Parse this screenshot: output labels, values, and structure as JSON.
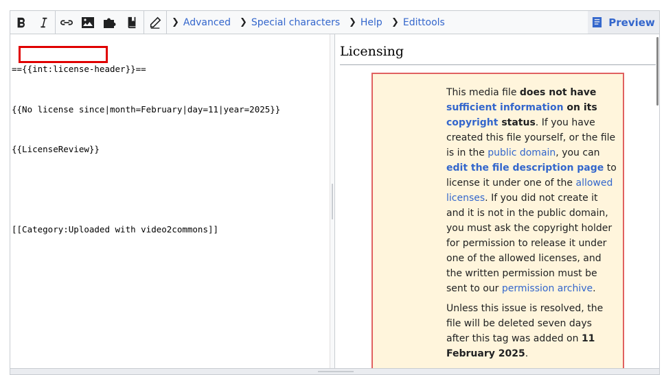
{
  "toolbar": {
    "tabs": [
      {
        "label": "Advanced"
      },
      {
        "label": "Special characters"
      },
      {
        "label": "Help"
      },
      {
        "label": "Edittools"
      }
    ],
    "preview_label": "Preview"
  },
  "editor": {
    "lines": [
      "=={{int:license-header}}==",
      "{{No license since|month=February|day=11|year=2025}}",
      "{{LicenseReview}}",
      "",
      "[[Category:Uploaded with video2commons]]"
    ]
  },
  "preview": {
    "heading": "Licensing",
    "notice": {
      "p1": {
        "t1": "This media file ",
        "b1": "does not have",
        "l1": "sufficient information",
        "b2": " on its",
        "l2": "copyright",
        "b3": " status",
        "t2": ". If you have created this file yourself, or the file is in the ",
        "l3": "public domain",
        "t3": ", you can ",
        "l4": "edit the file description page",
        "t4": " to license it under one of the ",
        "l5": "allowed licenses",
        "t5": ". If you did not create it and it is not in the public domain, you must ask the copyright holder for permission to release it under one of the allowed licenses, and the written permission must be sent to our ",
        "l6": "permission archive",
        "t6": "."
      },
      "p2": {
        "t1": "Unless this issue is resolved, the file will be deleted seven days after this tag was added on ",
        "b1": "11 February 2025",
        "t2": "."
      }
    }
  },
  "colors": {
    "link": "#3366cc",
    "highlight": "#e00000",
    "notice_bg": "#fff5dc",
    "notice_border": "#e06060"
  }
}
